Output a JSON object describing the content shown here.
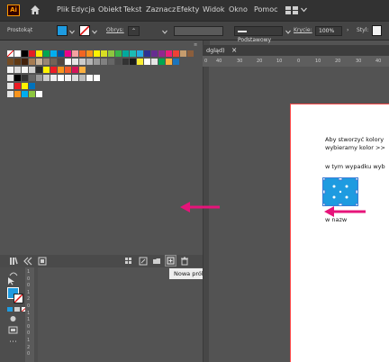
{
  "app": {
    "logo": "Ai"
  },
  "menubar": {
    "items": [
      "Plik",
      "Edycja",
      "Obiekt",
      "Tekst",
      "Zaznacz",
      "Efekty",
      "Widok",
      "Okno",
      "Pomoc"
    ]
  },
  "controlbar": {
    "selection_label": "Prostokąt",
    "stroke_label": "Obrys:",
    "brush_label": "Podstawowy",
    "opacity_label": "Krycie:",
    "opacity_value": "100%",
    "style_label": "Styl:"
  },
  "document_tab": {
    "label": "dgląd)",
    "close": "×"
  },
  "ruler": {
    "h_marks": [
      "0",
      "40",
      "30",
      "20",
      "10",
      "0",
      "10",
      "20",
      "30",
      "40"
    ]
  },
  "tools": {
    "ruler_marks": [
      "1",
      "0",
      "0",
      "1",
      "2",
      "0",
      "1",
      "1",
      "0",
      "0",
      "1",
      "2",
      "0"
    ]
  },
  "tooltip": {
    "text": "Nowa próbka"
  },
  "artboard": {
    "line1": "Aby stworzyć kolory",
    "line2": "wybieramy kolor >>",
    "line3": "w tym wypadku wyb",
    "line4": "w nazw"
  },
  "colors": {
    "accent_pink": "#e6147a",
    "selection_blue": "#1e9be0",
    "artboard_border": "#ff4a4a"
  }
}
